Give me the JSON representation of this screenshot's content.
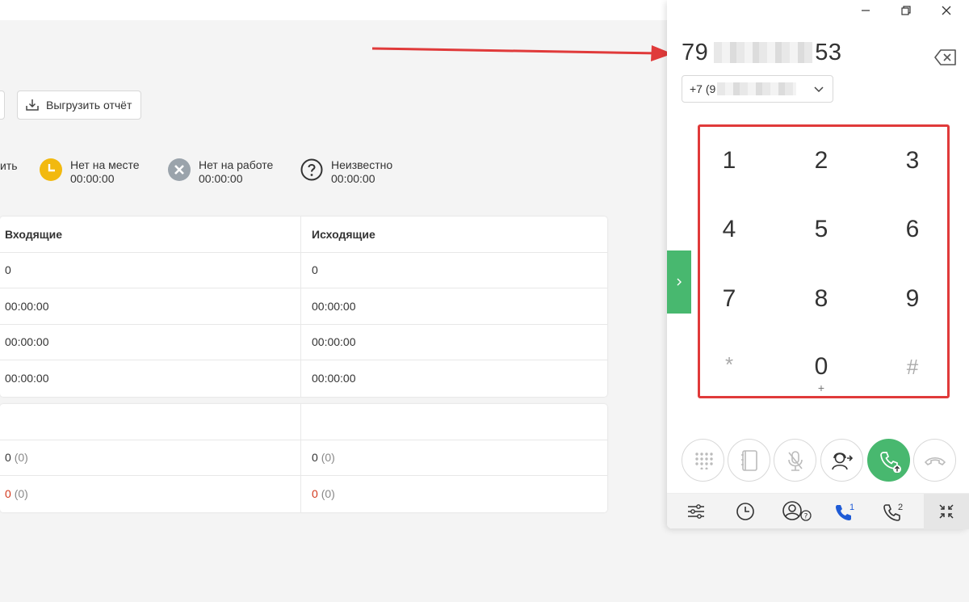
{
  "toolbar": {
    "export_label": "Выгрузить отчёт"
  },
  "statuses": [
    {
      "cut_label": "ить"
    },
    {
      "label": "Нет на месте",
      "time": "00:00:00"
    },
    {
      "label": "Нет на работе",
      "time": "00:00:00"
    },
    {
      "label": "Неизвестно",
      "time": "00:00:00"
    }
  ],
  "table1": {
    "headers": [
      "Входящие",
      "Исходящие"
    ],
    "rows": [
      [
        "0",
        "0"
      ],
      [
        "00:00:00",
        "00:00:00"
      ],
      [
        "00:00:00",
        "00:00:00"
      ],
      [
        "00:00:00",
        "00:00:00"
      ]
    ]
  },
  "table2": {
    "rows": [
      {
        "in_val": "0",
        "in_paren": "(0)",
        "out_val": "0",
        "out_paren": "(0)"
      },
      {
        "in_val": "0",
        "in_paren": "(0)",
        "out_val": "0",
        "out_paren": "(0)"
      }
    ]
  },
  "phone": {
    "number_start": "79",
    "number_end": "53",
    "line_prefix": "+7 (9",
    "keys": [
      "1",
      "2",
      "3",
      "4",
      "5",
      "6",
      "7",
      "8",
      "9",
      "*",
      "0",
      "#"
    ],
    "zero_sub": "+",
    "line1": "1",
    "line2": "2"
  },
  "colors": {
    "accent_green": "#48b86f",
    "highlight_red": "#e03a3a",
    "status_yellow": "#f2b90f",
    "status_gray": "#9aa3ab",
    "line_blue": "#1e5bd6"
  },
  "icons": {
    "export": "download-icon",
    "away": "clock-icon",
    "offline": "x-circle-icon",
    "unknown": "question-icon",
    "backspace": "backspace-icon",
    "actions": [
      "dialpad-icon",
      "contacts-book-icon",
      "mute-mic-icon",
      "transfer-icon",
      "call-icon",
      "hangup-icon"
    ],
    "bottom": [
      "settings-sliders-icon",
      "history-clock-icon",
      "operators-status-icon",
      "line-1-icon",
      "line-2-icon",
      "collapse-icon"
    ]
  }
}
